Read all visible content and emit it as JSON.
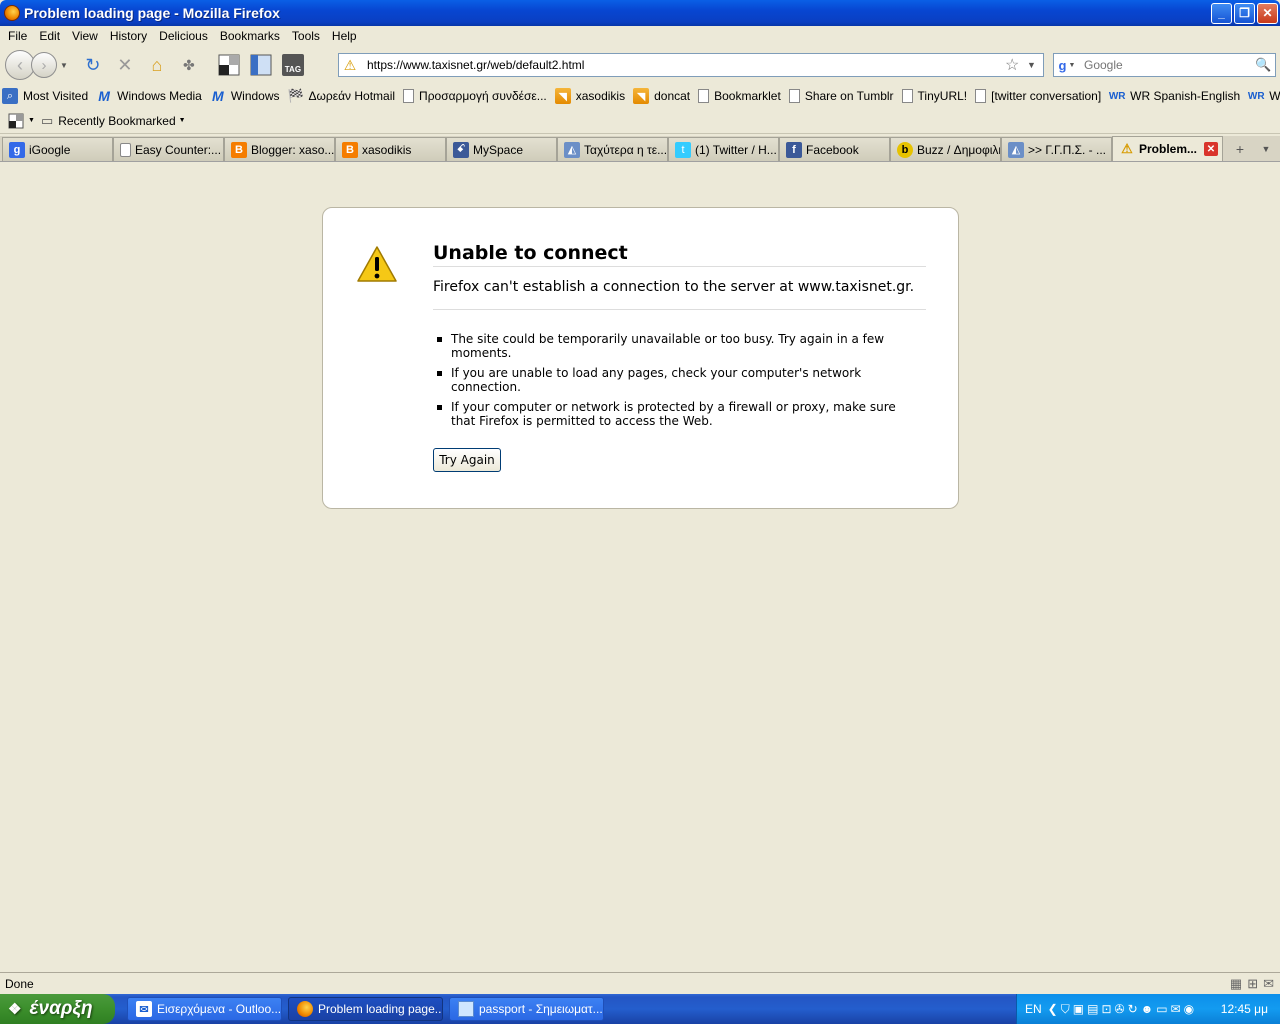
{
  "window": {
    "title": "Problem loading page - Mozilla Firefox"
  },
  "menu": [
    "File",
    "Edit",
    "View",
    "History",
    "Delicious",
    "Bookmarks",
    "Tools",
    "Help"
  ],
  "navbar": {
    "url": "https://www.taxisnet.gr/web/default2.html",
    "search_placeholder": "Google",
    "tag_label": "TAG"
  },
  "bookmarks": [
    {
      "label": "Most Visited",
      "icon": "most-visited-icon"
    },
    {
      "label": "Windows Media",
      "icon": "msn-icon"
    },
    {
      "label": "Windows",
      "icon": "msn-icon"
    },
    {
      "label": "Δωρεάν Hotmail",
      "icon": "windows-flag-icon"
    },
    {
      "label": "Προσαρμογή συνδέσε...",
      "icon": "page-icon"
    },
    {
      "label": "xasodikis",
      "icon": "rss-icon"
    },
    {
      "label": "doncat",
      "icon": "rss-icon"
    },
    {
      "label": "Bookmarklet",
      "icon": "page-icon"
    },
    {
      "label": "Share on Tumblr",
      "icon": "page-icon"
    },
    {
      "label": "TinyURL!",
      "icon": "page-icon"
    },
    {
      "label": "[twitter conversation]",
      "icon": "page-icon"
    },
    {
      "label": "WR Spanish-English",
      "icon": "wr-icon"
    },
    {
      "label": "WR English-Greek",
      "icon": "wr-icon"
    }
  ],
  "bookmarks2": {
    "recently_bookmarked": "Recently Bookmarked"
  },
  "tabs": [
    {
      "label": "iGoogle",
      "icon": "google-icon",
      "color": "#3369e8"
    },
    {
      "label": "Easy Counter:...",
      "icon": "page-icon",
      "color": "#ffffff"
    },
    {
      "label": "Blogger: xaso...",
      "icon": "blogger-icon",
      "color": "#f57d00"
    },
    {
      "label": "xasodikis",
      "icon": "blogger-icon",
      "color": "#f57d00"
    },
    {
      "label": "MySpace",
      "icon": "myspace-icon",
      "color": "#3b5998"
    },
    {
      "label": "Ταχύτερα η τε...",
      "icon": "site-icon",
      "color": "#6b8fc7"
    },
    {
      "label": "(1) Twitter / H...",
      "icon": "twitter-icon",
      "color": "#33ccff"
    },
    {
      "label": "Facebook",
      "icon": "facebook-icon",
      "color": "#3b5998"
    },
    {
      "label": "Buzz / Δημοφιλή",
      "icon": "buzz-icon",
      "color": "#e6c200"
    },
    {
      "label": ">> Γ.Γ.Π.Σ. - ...",
      "icon": "site-icon",
      "color": "#6b8fc7"
    },
    {
      "label": "Problem...",
      "icon": "warning-icon",
      "color": "#e6b800",
      "active": true
    }
  ],
  "error": {
    "title": "Unable to connect",
    "description": "Firefox can't establish a connection to the server at www.taxisnet.gr.",
    "bullets": [
      "The site could be temporarily unavailable or too busy. Try again in a few moments.",
      "If you are unable to load any pages, check your computer's network connection.",
      "If your computer or network is protected by a firewall or proxy, make sure that Firefox is permitted to access the Web."
    ],
    "button": "Try Again"
  },
  "status": {
    "text": "Done"
  },
  "taskbar": {
    "start": "έναρξη",
    "tasks": [
      {
        "label": "Εισερχόμενα - Outloo...",
        "icon": "outlook-icon"
      },
      {
        "label": "Problem loading page...",
        "icon": "firefox-icon",
        "active": true
      },
      {
        "label": "passport - Σημειωματ...",
        "icon": "notepad-icon"
      }
    ],
    "lang": "EN",
    "clock": "12:45 μμ"
  }
}
